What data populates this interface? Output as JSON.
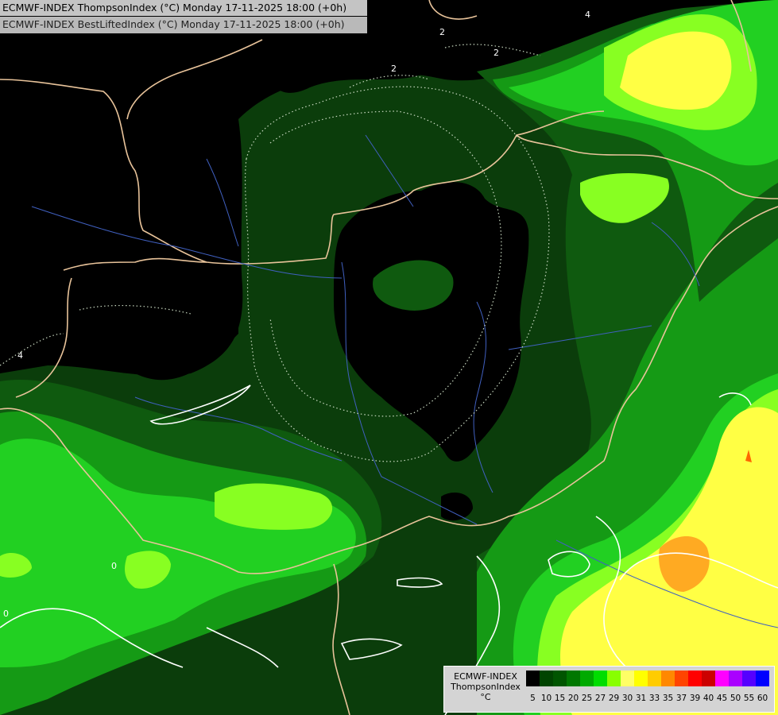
{
  "header": {
    "line1": "ECMWF-INDEX ThompsonIndex (°C) Monday 17-11-2025 18:00 (+0h)",
    "line2": "ECMWF-INDEX BestLiftedIndex (°C) Monday 17-11-2025 18:00 (+0h)"
  },
  "legend": {
    "title_line1": "ECMWF-INDEX",
    "title_line2": "ThompsonIndex",
    "title_line3": "°C",
    "ticks": [
      "5",
      "10",
      "15",
      "20",
      "25",
      "27",
      "29",
      "30",
      "31",
      "33",
      "35",
      "37",
      "39",
      "40",
      "45",
      "50",
      "55",
      "60"
    ],
    "colors": [
      "#000000",
      "#000000",
      "#000000",
      "#000000",
      "#004400",
      "#005500",
      "#007700",
      "#00aa00",
      "#00dd00",
      "#88ff00",
      "#ffff66",
      "#ffff00",
      "#ffcc00",
      "#ff8800",
      "#ff4400",
      "#ff0000",
      "#cc0000",
      "#ff00ff",
      "#aa00ff",
      "#5500ff",
      "#0000ff"
    ]
  },
  "contour_labels": [
    "2",
    "2",
    "2",
    "4",
    "0",
    "0",
    "4"
  ]
}
